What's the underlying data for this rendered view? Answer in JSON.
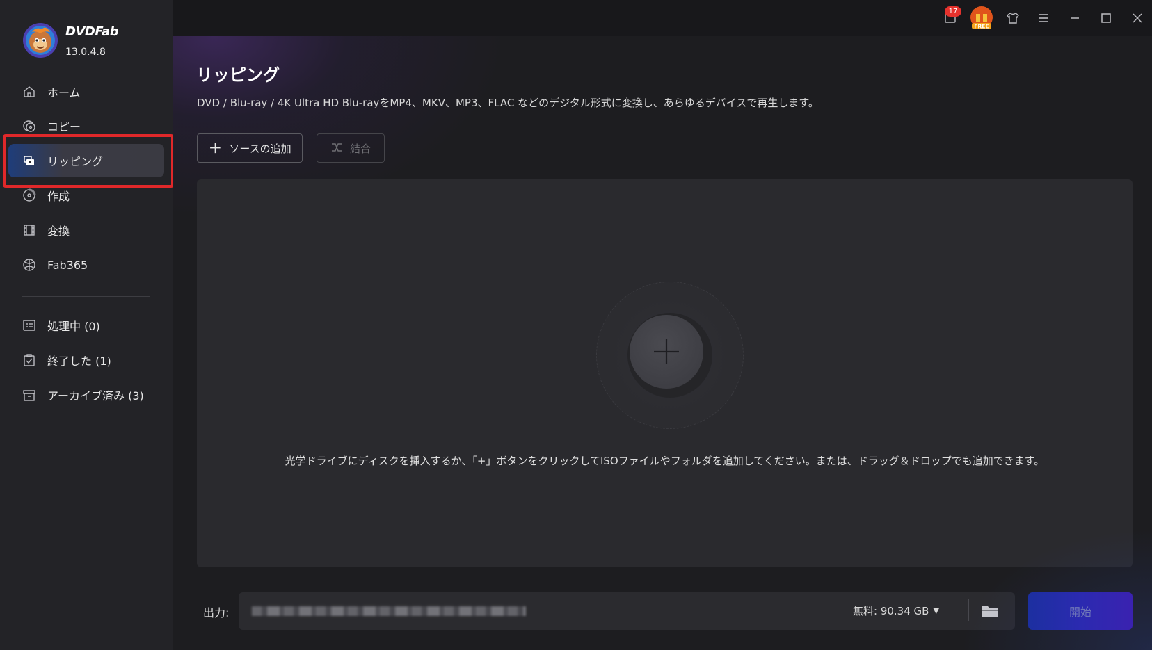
{
  "app": {
    "brand": "DVDFab",
    "version": "13.0.4.8"
  },
  "sidebar": {
    "items": [
      {
        "label": "ホーム",
        "icon": "home-icon"
      },
      {
        "label": "コピー",
        "icon": "copy-disc-icon"
      },
      {
        "label": "リッピング",
        "icon": "ripper-icon",
        "active": true
      },
      {
        "label": "作成",
        "icon": "creator-disc-icon"
      },
      {
        "label": "変換",
        "icon": "film-icon"
      },
      {
        "label": "Fab365",
        "icon": "fab365-icon"
      }
    ],
    "queue": [
      {
        "label": "処理中 (0)",
        "icon": "processing-list-icon"
      },
      {
        "label": "終了した (1)",
        "icon": "finished-clipboard-icon"
      },
      {
        "label": "アーカイブ済み (3)",
        "icon": "archive-box-icon"
      }
    ]
  },
  "titlebar": {
    "notification_count": "17",
    "free_badge": "FREE"
  },
  "main": {
    "title": "リッピング",
    "description": "DVD / Blu-ray / 4K Ultra HD Blu-rayをMP4、MKV、MP3、FLAC などのデジタル形式に変換し、あらゆるデバイスで再生します。",
    "add_source": "ソースの追加",
    "merge": "結合",
    "hint": "光学ドライブにディスクを挿入するか、「+」ボタンをクリックしてISOファイルやフォルダを追加してください。または、ドラッグ＆ドロップでも追加できます。"
  },
  "output": {
    "label": "出力:",
    "free_space": "無料:  90.34 GB",
    "start": "開始"
  },
  "colors": {
    "accent_blue": "#2b2ab0",
    "highlight_red": "#e0282a",
    "badge_red": "#e5322d"
  }
}
